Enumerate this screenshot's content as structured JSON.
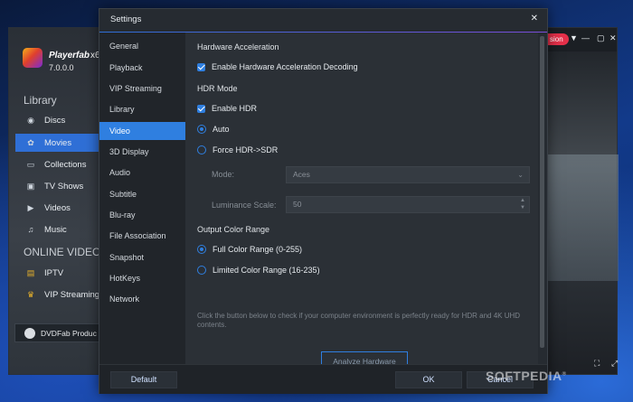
{
  "app": {
    "brand": "Playerfab",
    "brand_suffix": "x6",
    "version": "7.0.0.0",
    "library_title": "Library",
    "library_items": [
      {
        "label": "Discs",
        "icon": "disc-icon"
      },
      {
        "label": "Movies",
        "icon": "movie-reel-icon",
        "active": true
      },
      {
        "label": "Collections",
        "icon": "collections-icon"
      },
      {
        "label": "TV Shows",
        "icon": "tv-icon"
      },
      {
        "label": "Videos",
        "icon": "video-icon"
      },
      {
        "label": "Music",
        "icon": "music-note-icon"
      }
    ],
    "online_title": "ONLINE VIDEO",
    "online_items": [
      {
        "label": "IPTV",
        "icon": "iptv-icon"
      },
      {
        "label": "VIP Streaming",
        "icon": "vip-crown-icon"
      }
    ],
    "dvdfab_bar": "DVDFab Produc",
    "version_pill": "sion"
  },
  "settings": {
    "title": "Settings",
    "categories": [
      "General",
      "Playback",
      "VIP Streaming",
      "Library",
      "Video",
      "3D Display",
      "Audio",
      "Subtitle",
      "Blu-ray",
      "File Association",
      "Snapshot",
      "HotKeys",
      "Network"
    ],
    "active_category": "Video",
    "hw": {
      "heading": "Hardware Acceleration",
      "enable_label": "Enable Hardware Acceleration Decoding",
      "enabled": true
    },
    "hdr": {
      "heading": "HDR Mode",
      "enable_label": "Enable HDR",
      "enabled": true,
      "auto_label": "Auto",
      "force_label": "Force HDR->SDR",
      "selected": "Auto",
      "mode_label": "Mode:",
      "mode_value": "Aces",
      "luminance_label": "Luminance Scale:",
      "luminance_value": "50"
    },
    "color_range": {
      "heading": "Output Color Range",
      "full_label": "Full Color Range (0-255)",
      "limited_label": "Limited Color Range (16-235)",
      "selected": "Full Color Range (0-255)"
    },
    "info_text": "Click the button below to check if your computer environment is perfectly ready for HDR and 4K UHD contents.",
    "analyze_label": "Analyze Hardware",
    "footer": {
      "default_label": "Default",
      "ok_label": "OK",
      "cancel_label": "Cancel"
    }
  },
  "watermark": "SOFTPEDIA",
  "colors": {
    "accent": "#2f7fe0",
    "pill": "#e5304a"
  }
}
